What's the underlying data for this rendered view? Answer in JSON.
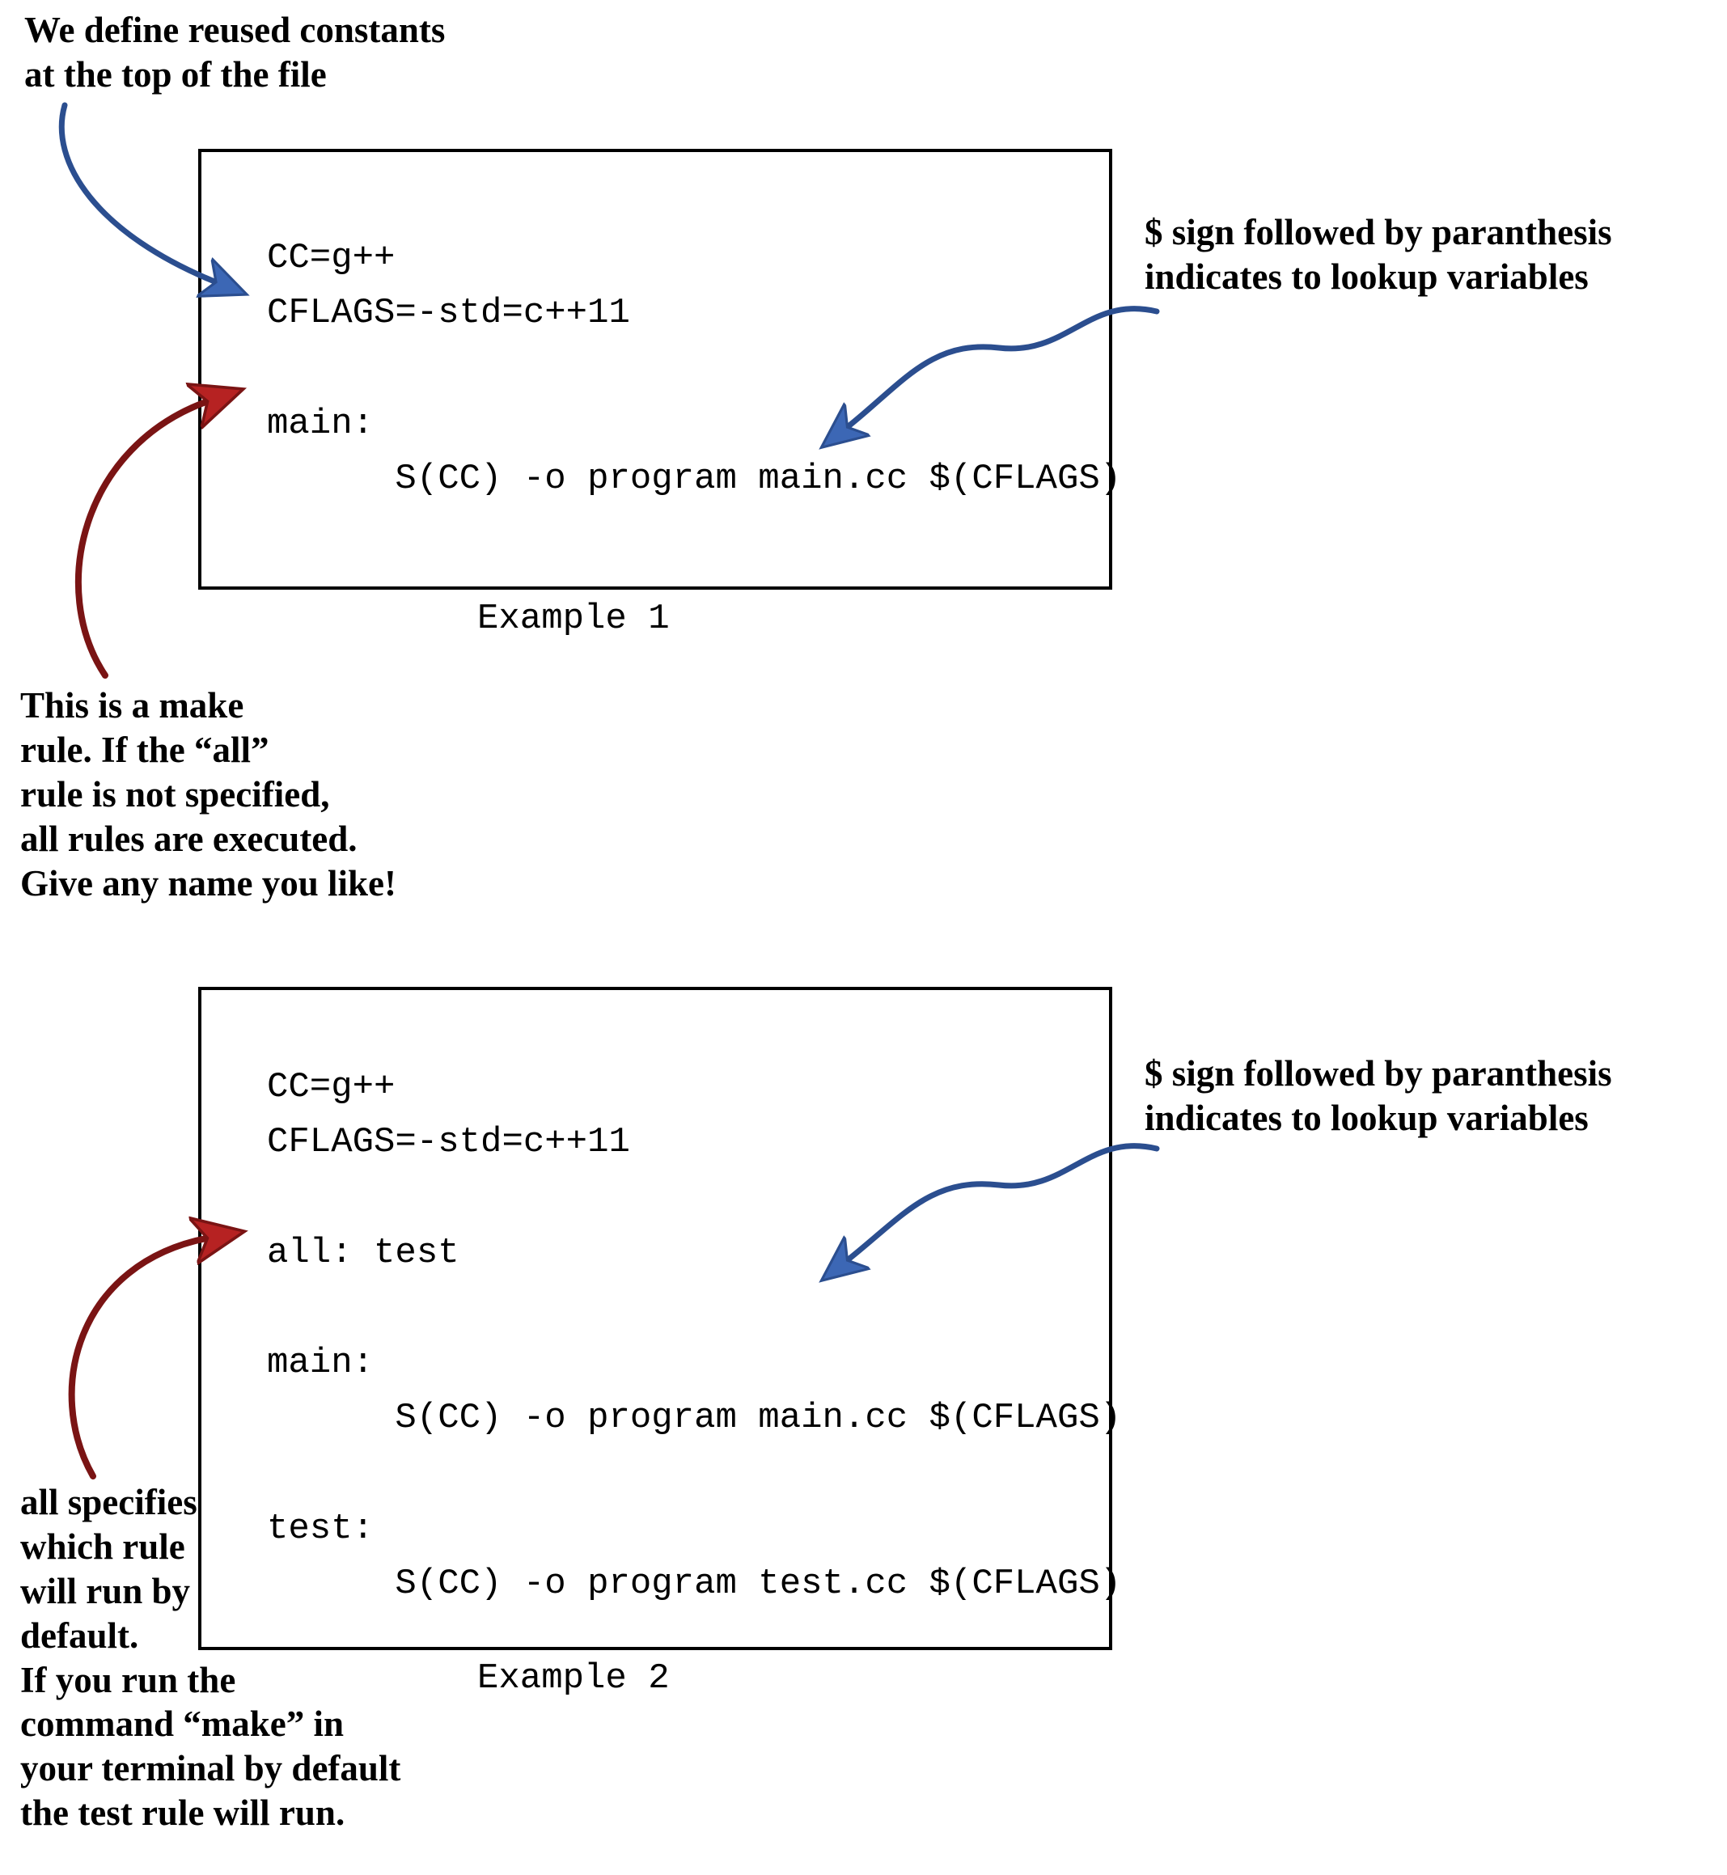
{
  "annotations": {
    "constants": "We define reused constants\nat the top of the file",
    "dollar1": "$ sign followed by paranthesis\nindicates to lookup variables",
    "rule": "This is a make\nrule. If the “all”\nrule is not specified,\nall rules are executed.\nGive any name you like!",
    "dollar2": "$ sign followed by paranthesis\nindicates to lookup variables",
    "all": "all specifies\nwhich rule\nwill run by\ndefault.\nIf you run the\ncommand “make” in\nyour terminal by default\nthe test rule will run."
  },
  "example1": {
    "caption": "Example 1",
    "code": "CC=g++\nCFLAGS=-std=c++11\n\nmain:\n      S(CC) -o program main.cc $(CFLAGS)"
  },
  "example2": {
    "caption": "Example 2",
    "code": "CC=g++\nCFLAGS=-std=c++11\n\nall: test\n\nmain:\n      S(CC) -o program main.cc $(CFLAGS)\n\ntest:\n      S(CC) -o program test.cc $(CFLAGS)"
  },
  "colors": {
    "blueStroke": "#2b4e8f",
    "blueFill": "#3c67b5",
    "redStroke": "#7a1414",
    "redFill": "#b62222"
  }
}
